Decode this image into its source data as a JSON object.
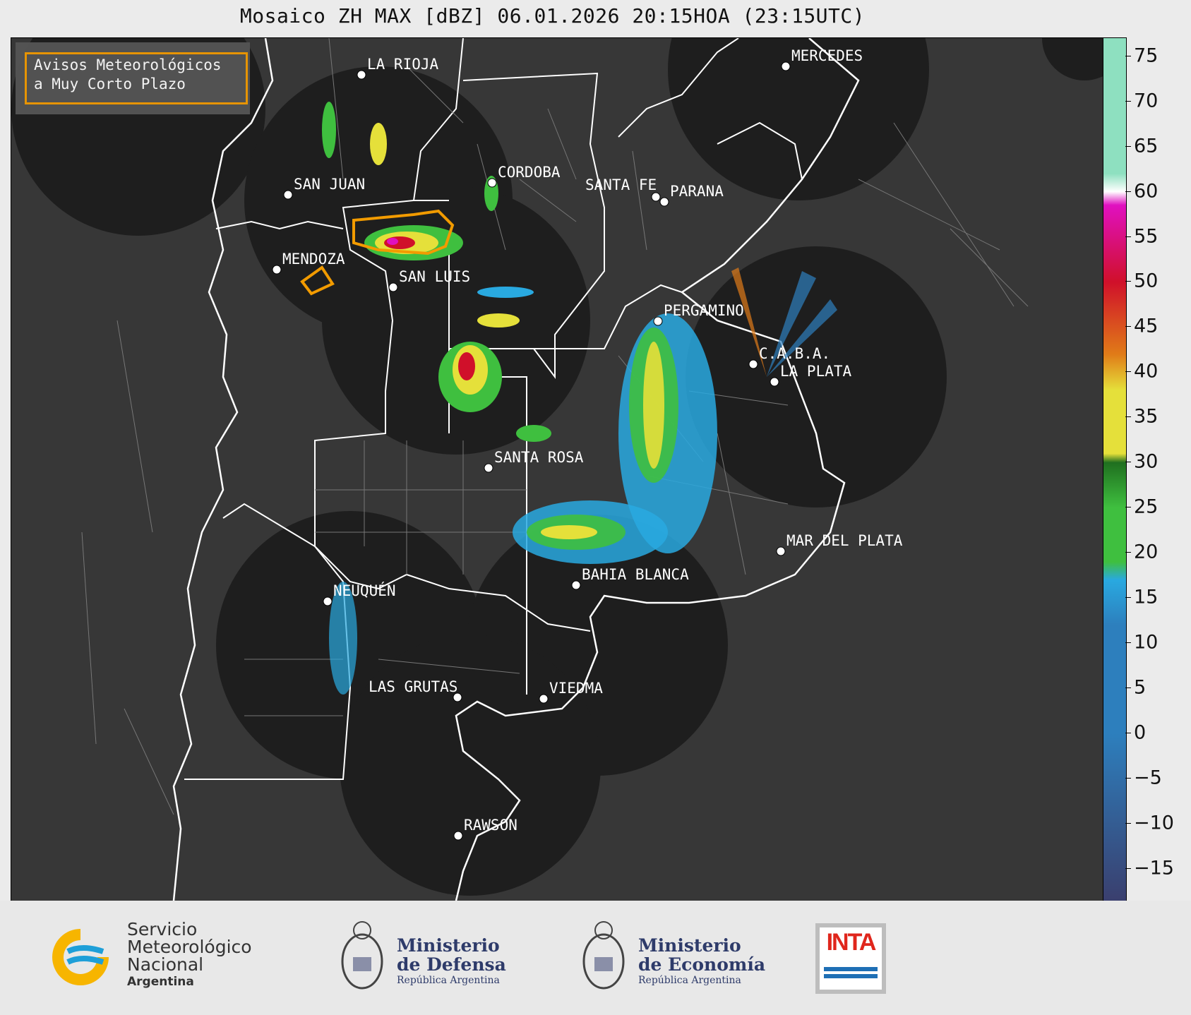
{
  "title": "Mosaico ZH MAX [dBZ] 06.01.2026 20:15HOA (23:15UTC)",
  "legend": {
    "line1": "Avisos Meteorológicos",
    "line2": "a Muy Corto Plazo",
    "color": "#f29b00"
  },
  "cities": [
    {
      "name": "LA RIOJA"
    },
    {
      "name": "MERCEDES"
    },
    {
      "name": "SAN JUAN"
    },
    {
      "name": "CORDOBA"
    },
    {
      "name": "SANTA FE"
    },
    {
      "name": "PARANA"
    },
    {
      "name": "MENDOZA"
    },
    {
      "name": "SAN LUIS"
    },
    {
      "name": "PERGAMINO"
    },
    {
      "name": "C.A.B.A."
    },
    {
      "name": "LA PLATA"
    },
    {
      "name": "SANTA ROSA"
    },
    {
      "name": "MAR DEL PLATA"
    },
    {
      "name": "BAHIA BLANCA"
    },
    {
      "name": "NEUQUÉN"
    },
    {
      "name": "LAS GRUTAS"
    },
    {
      "name": "VIEDMA"
    },
    {
      "name": "RAWSON"
    }
  ],
  "colorbar": {
    "ticks": [
      "75",
      "70",
      "65",
      "60",
      "55",
      "50",
      "45",
      "40",
      "35",
      "30",
      "25",
      "20",
      "15",
      "10",
      "5",
      "0",
      "−5",
      "−10",
      "−15"
    ],
    "min": -18.5,
    "max": 77,
    "colors": {
      "low": "#3a3f6e",
      "blue": "#2d7fbd",
      "cyan": "#29a9e0",
      "green": "#3fbf3f",
      "dark_green": "#1f6f1f",
      "yellow": "#e5e03a",
      "orange": "#e07b18",
      "red": "#d0102a",
      "magenta": "#e010c0",
      "white": "#ffffff",
      "mint": "#8ee0c0"
    }
  },
  "footer": {
    "smn": {
      "line1": "Servicio",
      "line2": "Meteorológico",
      "line3": "Nacional",
      "line4": "Argentina"
    },
    "defensa": {
      "line1": "Ministerio",
      "line2": "de Defensa",
      "line3": "República Argentina"
    },
    "economia": {
      "line1": "Ministerio",
      "line2": "de Economía",
      "line3": "República Argentina"
    },
    "inta": {
      "label": "INTA",
      "color": "#e0261c",
      "stripe_color": "#1e6fb5"
    }
  }
}
